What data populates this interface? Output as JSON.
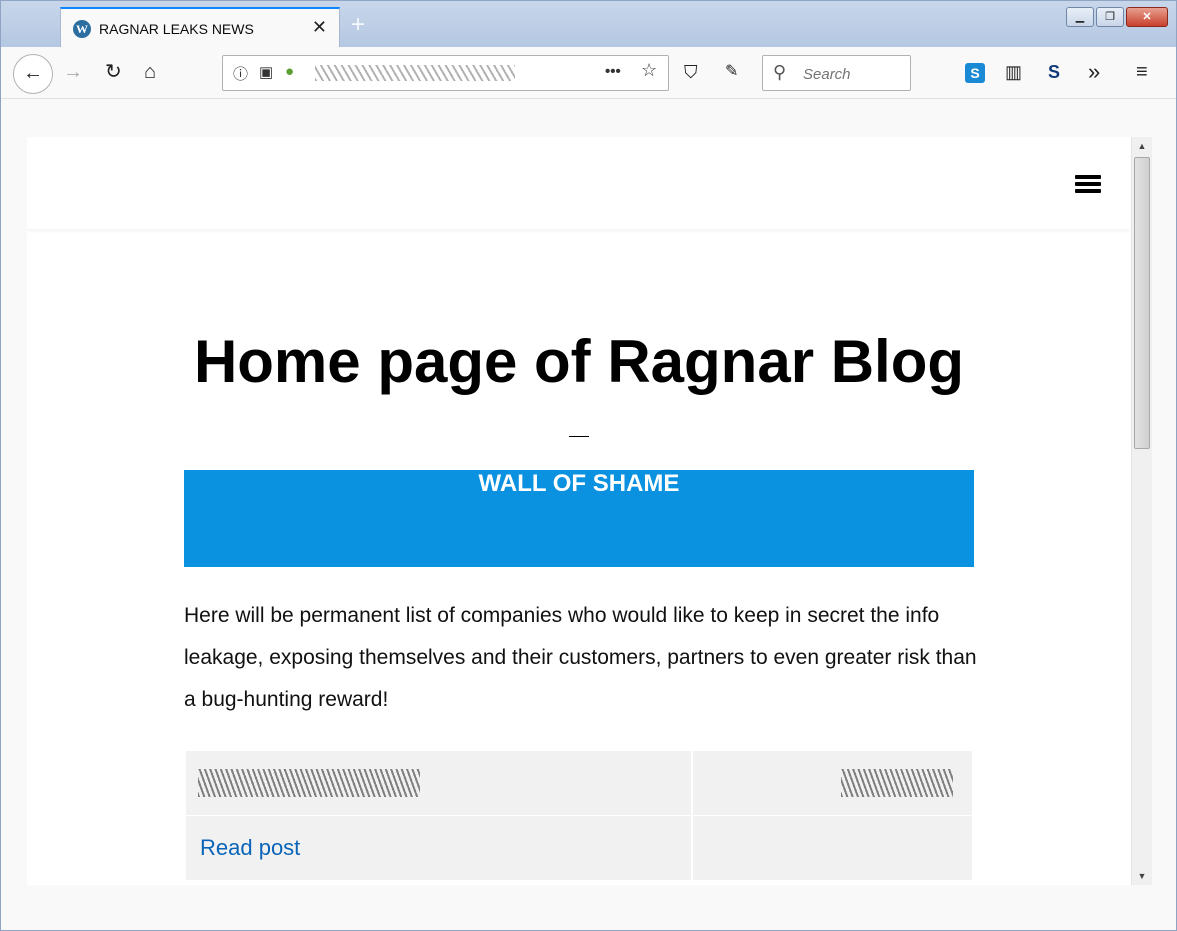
{
  "browser": {
    "tab_title": "RAGNAR LEAKS NEWS",
    "tab_close": "✕",
    "new_tab": "+",
    "search_placeholder": "Search",
    "icons": [
      "back-icon",
      "forward-icon",
      "reload-icon",
      "home-icon",
      "info-icon",
      "image-icon",
      "pear-icon",
      "more-icon",
      "star-icon",
      "shield-icon",
      "broom-icon",
      "search-icon",
      "skype-icon",
      "sidebar-icon",
      "s-extension-icon",
      "overflow-icon",
      "menu-icon"
    ]
  },
  "page": {
    "title": "Home page of Ragnar Blog",
    "banner": "WALL OF SHAME",
    "intro": "Here will be permanent list of companies who would like to keep in secret the info leakage, exposing themselves and their customers, partners to even greater risk than a bug-hunting reward!",
    "read_post": "Read post",
    "banner_color": "#0a91e0",
    "link_color": "#0a65b8"
  }
}
